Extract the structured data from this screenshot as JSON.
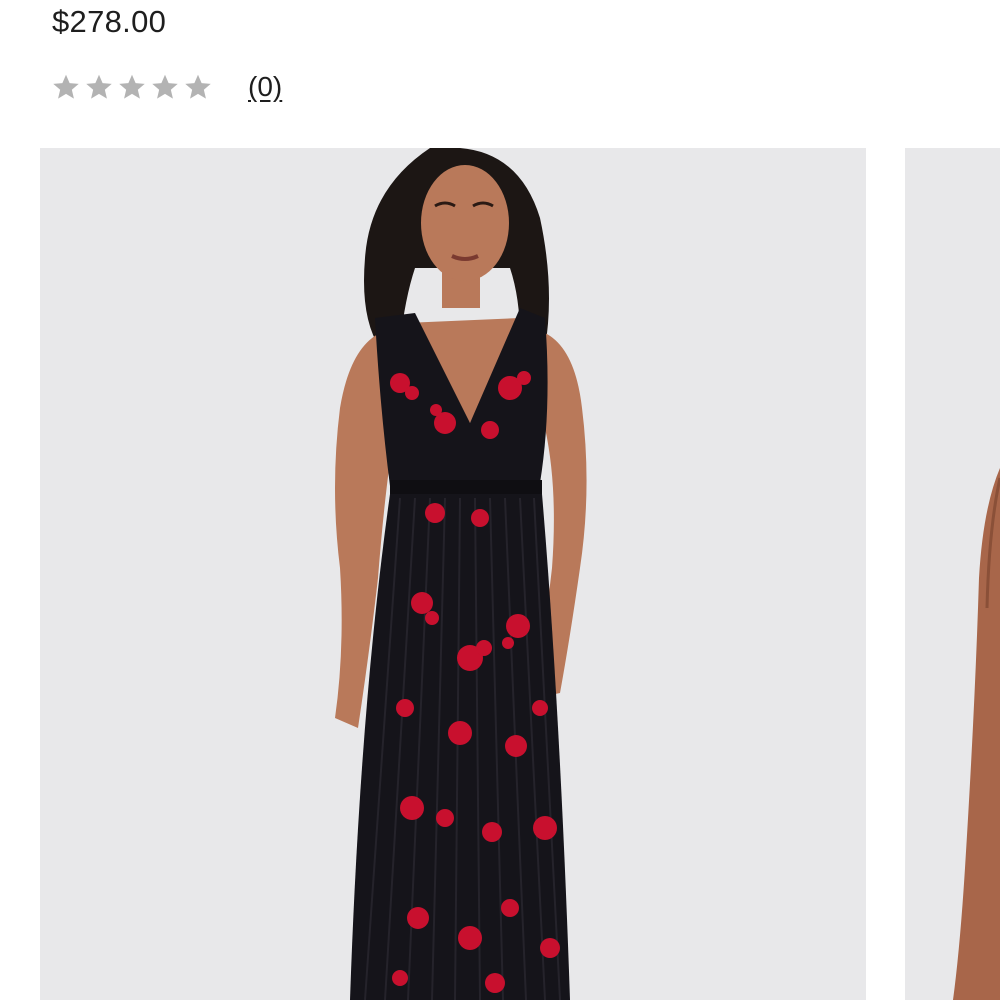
{
  "product": {
    "price": "$278.00"
  },
  "rating": {
    "stars_filled": 0,
    "stars_total": 5,
    "review_count_label": "(0)",
    "star_color": "#b3b3b3"
  },
  "gallery": {
    "background_color": "#e8e8ea",
    "dress_color": "#15141a",
    "print_color": "#c8102e",
    "skin_color": "#b9795a"
  }
}
